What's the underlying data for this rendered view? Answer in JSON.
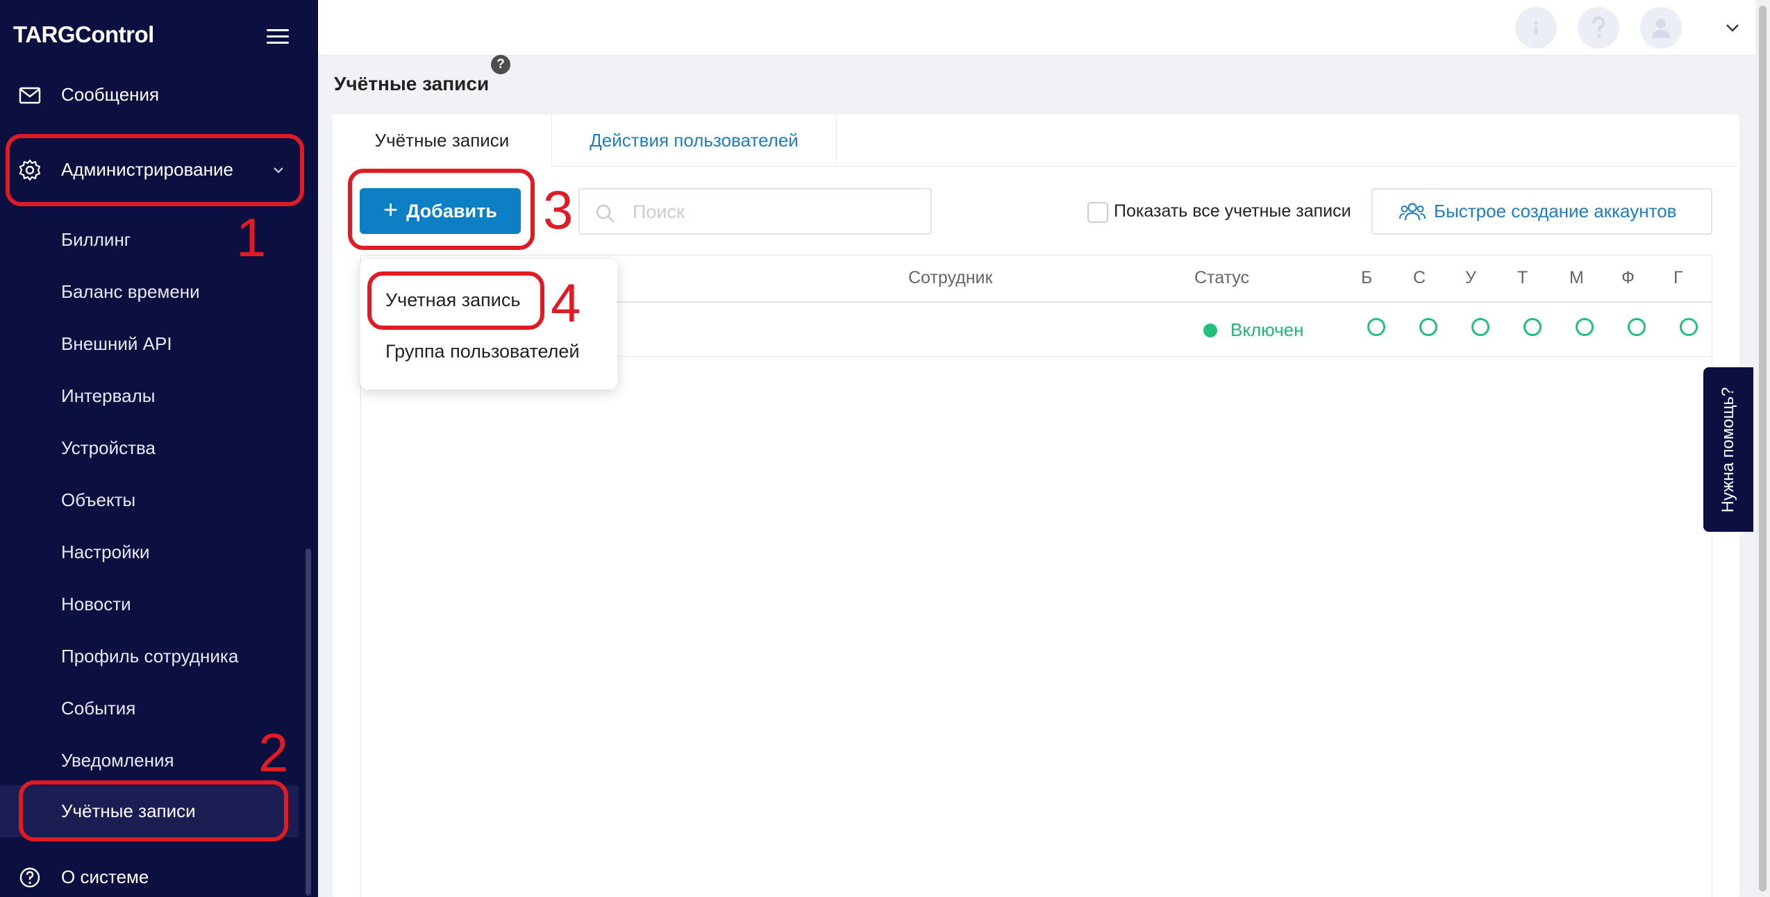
{
  "app": {
    "logo": "TARGControl"
  },
  "sidebar": {
    "top_items": [
      {
        "label": "Сообщения",
        "icon": "mail-icon"
      },
      {
        "label": "Администрирование",
        "icon": "gear-icon"
      }
    ],
    "sub_items": [
      "Биллинг",
      "Баланс времени",
      "Внешний API",
      "Интервалы",
      "Устройства",
      "Объекты",
      "Настройки",
      "Новости",
      "Профиль сотрудника",
      "События",
      "Уведомления",
      "Учётные записи"
    ],
    "active_sub": "Учётные записи",
    "bottom_item": {
      "label": "О системе",
      "icon": "question-circle-icon"
    }
  },
  "page": {
    "title": "Учётные записи",
    "help_badge": "?",
    "tabs": [
      "Учётные записи",
      "Действия пользователей"
    ]
  },
  "toolbar": {
    "add_label": "Добавить",
    "search_placeholder": "Поиск",
    "show_all_label": "Показать все учетные записи",
    "quick_create_label": "Быстрое создание аккаунтов"
  },
  "dropdown": {
    "items": [
      "Учетная запись",
      "Группа пользователей"
    ]
  },
  "table": {
    "headers": {
      "employee": "Сотрудник",
      "status": "Статус",
      "flags": [
        "Б",
        "С",
        "У",
        "Т",
        "М",
        "Ф",
        "Г"
      ]
    },
    "rows": [
      {
        "status": "Включен"
      }
    ]
  },
  "help_tab": {
    "label": "Нужна помощь?"
  },
  "annotations": [
    "1",
    "2",
    "3",
    "4"
  ],
  "colors": {
    "sidebar_bg": "#0c1040",
    "accent": "#0d7fc4",
    "status_green": "#22b573",
    "annotation_red": "#e01b24"
  }
}
